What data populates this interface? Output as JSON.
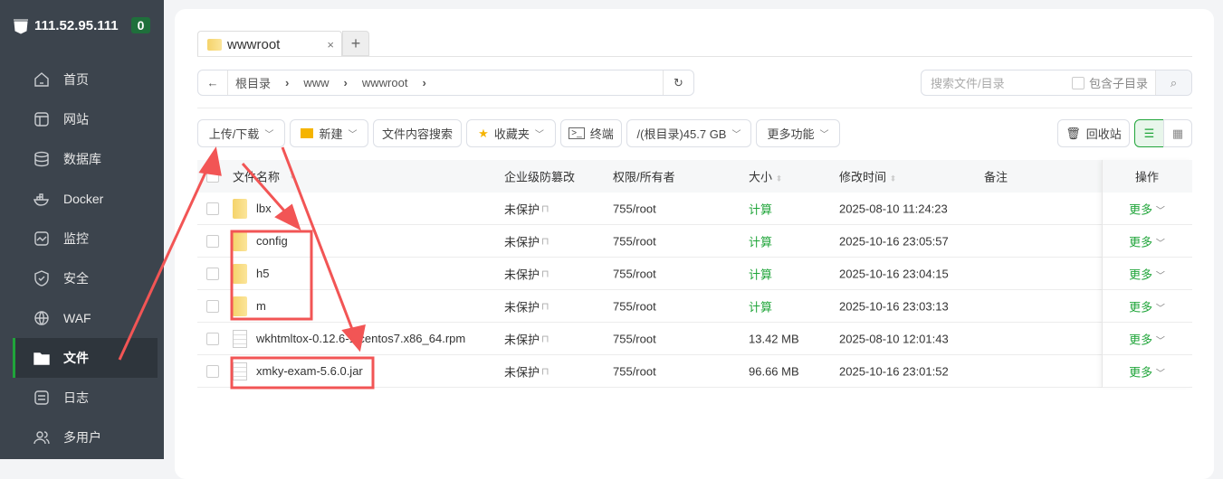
{
  "server": {
    "ip": "111.52.95.111",
    "count": "0"
  },
  "sidebar": {
    "items": [
      {
        "label": "首页",
        "icon": "home-icon"
      },
      {
        "label": "网站",
        "icon": "website-icon"
      },
      {
        "label": "数据库",
        "icon": "database-icon"
      },
      {
        "label": "Docker",
        "icon": "docker-icon"
      },
      {
        "label": "监控",
        "icon": "monitor-icon"
      },
      {
        "label": "安全",
        "icon": "shield-icon"
      },
      {
        "label": "WAF",
        "icon": "waf-icon"
      },
      {
        "label": "文件",
        "icon": "folder-icon"
      },
      {
        "label": "日志",
        "icon": "log-icon"
      },
      {
        "label": "多用户",
        "icon": "users-icon"
      }
    ]
  },
  "tab": {
    "label": "wwwroot",
    "close": "×",
    "add": "+"
  },
  "path": {
    "crumbs": [
      "根目录",
      "www",
      "wwwroot"
    ]
  },
  "search": {
    "placeholder": "搜索文件/目录",
    "subdir": "包含子目录"
  },
  "toolbar": {
    "upload": "上传/下载",
    "new": "新建",
    "content_search": "文件内容搜索",
    "favorites": "收藏夹",
    "terminal": "终端",
    "disk": "/(根目录)45.7 GB",
    "more": "更多功能",
    "recycle": "回收站"
  },
  "table": {
    "headers": {
      "name": "文件名称",
      "protect": "企业级防篡改",
      "perm": "权限/所有者",
      "size": "大小",
      "mtime": "修改时间",
      "note": "备注",
      "ops": "操作"
    },
    "rows": [
      {
        "name": "lbx",
        "type": "folder",
        "protect": "未保护",
        "perm": "755/root",
        "size": "计算",
        "mtime": "2025-08-10 11:24:23",
        "ops": "更多"
      },
      {
        "name": "config",
        "type": "folder",
        "protect": "未保护",
        "perm": "755/root",
        "size": "计算",
        "mtime": "2025-10-16 23:05:57",
        "ops": "更多"
      },
      {
        "name": "h5",
        "type": "folder",
        "protect": "未保护",
        "perm": "755/root",
        "size": "计算",
        "mtime": "2025-10-16 23:04:15",
        "ops": "更多"
      },
      {
        "name": "m",
        "type": "folder",
        "protect": "未保护",
        "perm": "755/root",
        "size": "计算",
        "mtime": "2025-10-16 23:03:13",
        "ops": "更多"
      },
      {
        "name": "wkhtmltox-0.12.6-1.centos7.x86_64.rpm",
        "type": "file",
        "protect": "未保护",
        "perm": "755/root",
        "size": "13.42 MB",
        "mtime": "2025-08-10 12:01:43",
        "ops": "更多"
      },
      {
        "name": "xmky-exam-5.6.0.jar",
        "type": "file",
        "protect": "未保护",
        "perm": "755/root",
        "size": "96.66 MB",
        "mtime": "2025-10-16 23:01:52",
        "ops": "更多"
      }
    ]
  },
  "colors": {
    "accent": "#20a53a",
    "sidebar": "#3c444d",
    "annotation": "#f25555"
  }
}
